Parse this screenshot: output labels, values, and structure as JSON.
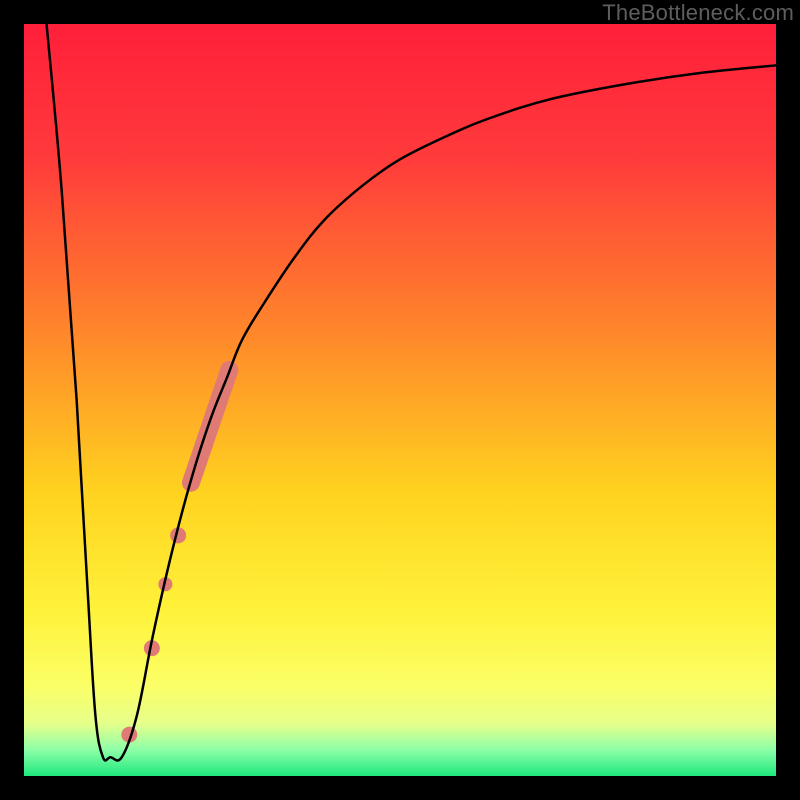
{
  "watermark": {
    "text": "TheBottleneck.com"
  },
  "chart_data": {
    "type": "line",
    "title": "",
    "xlabel": "",
    "ylabel": "",
    "xlim": [
      0,
      100
    ],
    "ylim": [
      0,
      100
    ],
    "gradient_stops": [
      {
        "offset": 0.0,
        "color": "#ff1f3a"
      },
      {
        "offset": 0.18,
        "color": "#ff3b3b"
      },
      {
        "offset": 0.42,
        "color": "#ff8a2a"
      },
      {
        "offset": 0.62,
        "color": "#ffd21f"
      },
      {
        "offset": 0.78,
        "color": "#fff23a"
      },
      {
        "offset": 0.88,
        "color": "#fbff66"
      },
      {
        "offset": 0.93,
        "color": "#e6ff8a"
      },
      {
        "offset": 0.965,
        "color": "#8effa8"
      },
      {
        "offset": 1.0,
        "color": "#1ee87d"
      }
    ],
    "series": [
      {
        "name": "bottleneck-curve",
        "color": "#000000",
        "stroke_width": 2.5,
        "x": [
          3,
          5,
          7,
          8.5,
          9.5,
          10.5,
          11.5,
          13,
          15,
          17,
          19,
          21,
          23,
          25,
          27,
          29,
          32,
          36,
          40,
          45,
          50,
          56,
          62,
          70,
          80,
          90,
          100
        ],
        "y": [
          100,
          78,
          50,
          24,
          8,
          2.5,
          2.5,
          2.5,
          8,
          18,
          27,
          35,
          42,
          48,
          53,
          58,
          63,
          69,
          74,
          78.5,
          82,
          85,
          87.5,
          90,
          92,
          93.5,
          94.5
        ]
      }
    ],
    "markers": [
      {
        "name": "highlight-segment",
        "type": "thick-line",
        "color": "#e07a74",
        "width": 18,
        "points": [
          {
            "x": 22.2,
            "y": 39
          },
          {
            "x": 27.3,
            "y": 54
          }
        ]
      },
      {
        "name": "dot-1",
        "type": "circle",
        "color": "#e07a74",
        "r": 8,
        "x": 20.5,
        "y": 32
      },
      {
        "name": "dot-2",
        "type": "circle",
        "color": "#e07a74",
        "r": 7,
        "x": 18.8,
        "y": 25.5
      },
      {
        "name": "dot-3",
        "type": "circle",
        "color": "#e07a74",
        "r": 8,
        "x": 17.0,
        "y": 17
      },
      {
        "name": "dot-4",
        "type": "circle",
        "color": "#e07a74",
        "r": 8,
        "x": 14.0,
        "y": 5.5
      }
    ]
  }
}
